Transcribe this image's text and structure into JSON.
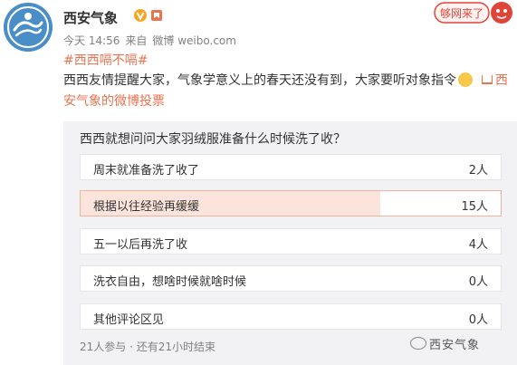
{
  "post": {
    "username": "西安气象",
    "time": "今天 14:56",
    "source_prefix": "来自",
    "source": "微博 weibo.com",
    "topic": "#西西嗝不嗝#",
    "text": "西西友情提醒大家，气象学意义上的春天还没有到，大家要听对象指令",
    "link_text": "西安气象的微博投票",
    "sticker_text": "够网来了"
  },
  "poll": {
    "question": "西西就想问问大家羽绒服准备什么时候洗了收？",
    "total_votes": 21,
    "options": [
      {
        "label": "周末就准备洗了收了",
        "count": "2人",
        "votes": 2,
        "selected": false
      },
      {
        "label": "根据以往经验再缓缓",
        "count": "15人",
        "votes": 15,
        "selected": true
      },
      {
        "label": "五一以后再洗了收",
        "count": "4人",
        "votes": 4,
        "selected": false
      },
      {
        "label": "洗衣自由，想啥时候就啥时候",
        "count": "0人",
        "votes": 0,
        "selected": false
      },
      {
        "label": "其他评论区见",
        "count": "0人",
        "votes": 0,
        "selected": false
      }
    ],
    "footer": "21人参与 · 还有21小时结束",
    "watermark": "西安气象"
  },
  "icons": {
    "avatar": "weather-swirl-logo",
    "verified": "verified-v-icon",
    "tag": "member-badge-icon",
    "emoji": "smile-emoji-icon",
    "link": "poll-link-icon"
  },
  "colors": {
    "accent": "#eb7350",
    "poll_bg": "#f2f2f5",
    "selected_fill": "#fbe4dc",
    "verified": "#f5a623",
    "avatar_bg": "#4a8ec8"
  }
}
